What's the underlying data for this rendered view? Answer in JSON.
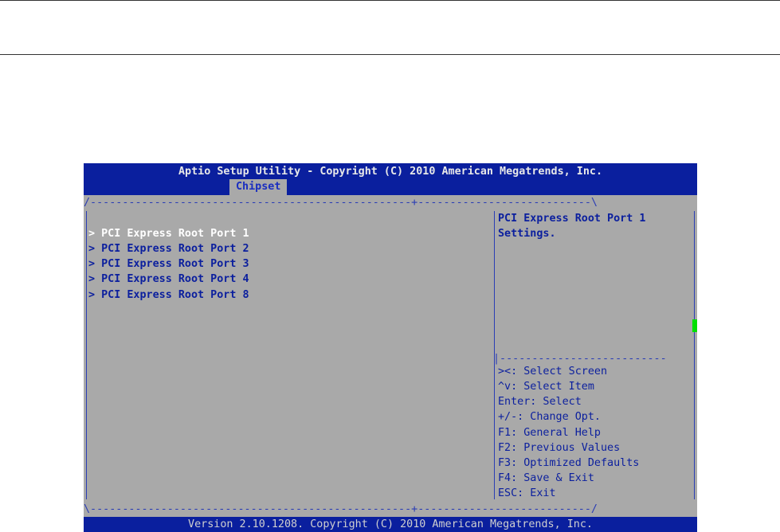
{
  "header": {
    "title": "Aptio Setup Utility - Copyright (C) 2010 American Megatrends, Inc.",
    "active_tab": "Chipset"
  },
  "menu": {
    "items": [
      {
        "label": "> PCI Express Root Port 1",
        "selected": true
      },
      {
        "label": "> PCI Express Root Port 2",
        "selected": false
      },
      {
        "label": "> PCI Express Root Port 3",
        "selected": false
      },
      {
        "label": "> PCI Express Root Port 4",
        "selected": false
      },
      {
        "label": "> PCI Express Root Port 8",
        "selected": false
      }
    ]
  },
  "help": {
    "lines": [
      "PCI Express Root Port 1",
      "Settings."
    ]
  },
  "keys": {
    "lines": [
      "><: Select Screen",
      "^v: Select Item",
      "Enter: Select",
      "+/-: Change Opt.",
      "F1: General Help",
      "F2: Previous Values",
      "F3: Optimized Defaults",
      "F4: Save & Exit",
      "ESC: Exit"
    ]
  },
  "footer": {
    "version": "Version 2.10.1208. Copyright (C) 2010 American Megatrends, Inc."
  },
  "colors": {
    "bar": "#0a1f9e",
    "panel": "#a9a9a9",
    "text": "#0b1f9e",
    "scroll_indicator": "#00e000"
  }
}
